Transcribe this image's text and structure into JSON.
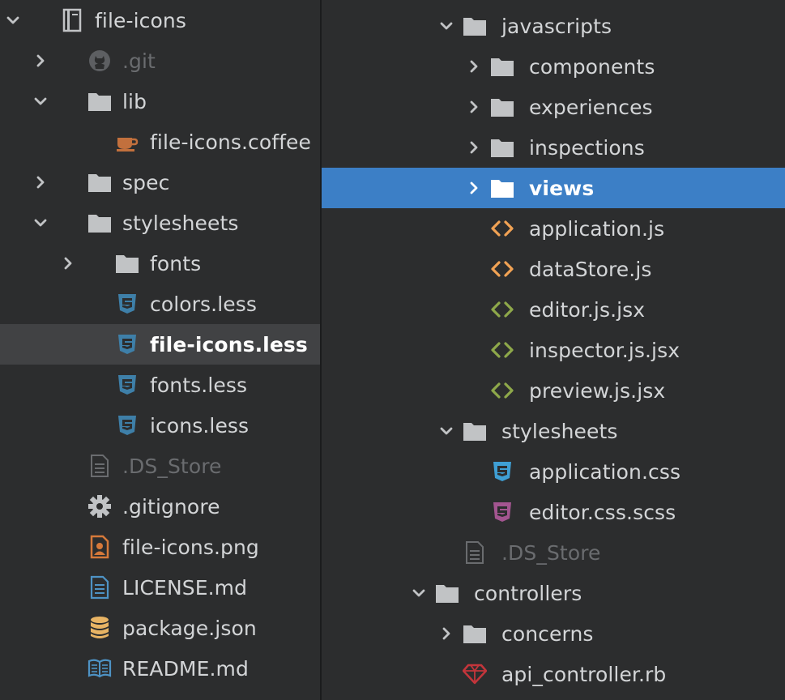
{
  "colors": {
    "panel_bg": "#2c2d2e",
    "row_selected_gray": "#414244",
    "row_selected_blue": "#3c7fc6",
    "text": "#d3d5d7",
    "text_dim": "#6a6c6f",
    "folder_icon": "#c1c3c5",
    "coffee_icon": "#c2703d",
    "less_icon": "#3e7fa8",
    "css_icon": "#3f9fd4",
    "scss_icon": "#a35590",
    "js_icon": "#f1a254",
    "jsx_icon": "#8ea84a",
    "ruby_icon": "#c3353b",
    "image_icon": "#d6793a",
    "json_icon": "#e8b464",
    "readme_icon": "#4e93c5"
  },
  "left_tree": [
    {
      "label": "file-icons",
      "icon": "book-icon",
      "chevron": "down",
      "style": "normal"
    },
    {
      "label": ".git",
      "icon": "github-icon",
      "chevron": "right",
      "style": "dim"
    },
    {
      "label": "lib",
      "icon": "folder-icon",
      "chevron": "down",
      "style": "normal"
    },
    {
      "label": "file-icons.coffee",
      "icon": "coffee-icon",
      "chevron": "",
      "style": "normal"
    },
    {
      "label": "spec",
      "icon": "folder-icon",
      "chevron": "right",
      "style": "normal"
    },
    {
      "label": "stylesheets",
      "icon": "folder-icon",
      "chevron": "down",
      "style": "normal"
    },
    {
      "label": "fonts",
      "icon": "folder-icon",
      "chevron": "right",
      "style": "normal"
    },
    {
      "label": "colors.less",
      "icon": "less-icon",
      "chevron": "",
      "style": "normal"
    },
    {
      "label": "file-icons.less",
      "icon": "less-icon",
      "chevron": "",
      "style": "selected"
    },
    {
      "label": "fonts.less",
      "icon": "less-icon",
      "chevron": "",
      "style": "normal"
    },
    {
      "label": "icons.less",
      "icon": "less-icon",
      "chevron": "",
      "style": "normal"
    },
    {
      "label": ".DS_Store",
      "icon": "text-file-icon",
      "chevron": "",
      "style": "dim"
    },
    {
      "label": ".gitignore",
      "icon": "gear-icon",
      "chevron": "",
      "style": "normal"
    },
    {
      "label": "file-icons.png",
      "icon": "image-file-icon",
      "chevron": "",
      "style": "normal"
    },
    {
      "label": "LICENSE.md",
      "icon": "document-icon",
      "chevron": "",
      "style": "normal"
    },
    {
      "label": "package.json",
      "icon": "database-icon",
      "chevron": "",
      "style": "normal"
    },
    {
      "label": "README.md",
      "icon": "book-open-icon",
      "chevron": "",
      "style": "normal"
    }
  ],
  "right_tree": [
    {
      "label": "javascripts",
      "icon": "folder-icon",
      "chevron": "down",
      "style": "normal"
    },
    {
      "label": "components",
      "icon": "folder-icon",
      "chevron": "right",
      "style": "normal"
    },
    {
      "label": "experiences",
      "icon": "folder-icon",
      "chevron": "right",
      "style": "normal"
    },
    {
      "label": "inspections",
      "icon": "folder-icon",
      "chevron": "right",
      "style": "normal"
    },
    {
      "label": "views",
      "icon": "folder-icon",
      "chevron": "right",
      "style": "selected"
    },
    {
      "label": "application.js",
      "icon": "js-code-icon",
      "chevron": "",
      "style": "normal"
    },
    {
      "label": "dataStore.js",
      "icon": "js-code-icon",
      "chevron": "",
      "style": "normal"
    },
    {
      "label": "editor.js.jsx",
      "icon": "jsx-code-icon",
      "chevron": "",
      "style": "normal"
    },
    {
      "label": "inspector.js.jsx",
      "icon": "jsx-code-icon",
      "chevron": "",
      "style": "normal"
    },
    {
      "label": "preview.js.jsx",
      "icon": "jsx-code-icon",
      "chevron": "",
      "style": "normal"
    },
    {
      "label": "stylesheets",
      "icon": "folder-icon",
      "chevron": "down",
      "style": "normal"
    },
    {
      "label": "application.css",
      "icon": "css-icon",
      "chevron": "",
      "style": "normal"
    },
    {
      "label": "editor.css.scss",
      "icon": "scss-icon",
      "chevron": "",
      "style": "normal"
    },
    {
      "label": ".DS_Store",
      "icon": "text-file-icon",
      "chevron": "",
      "style": "dim"
    },
    {
      "label": "controllers",
      "icon": "folder-icon",
      "chevron": "down",
      "style": "normal"
    },
    {
      "label": "concerns",
      "icon": "folder-icon",
      "chevron": "right",
      "style": "normal"
    },
    {
      "label": "api_controller.rb",
      "icon": "ruby-gem-icon",
      "chevron": "",
      "style": "normal"
    }
  ]
}
